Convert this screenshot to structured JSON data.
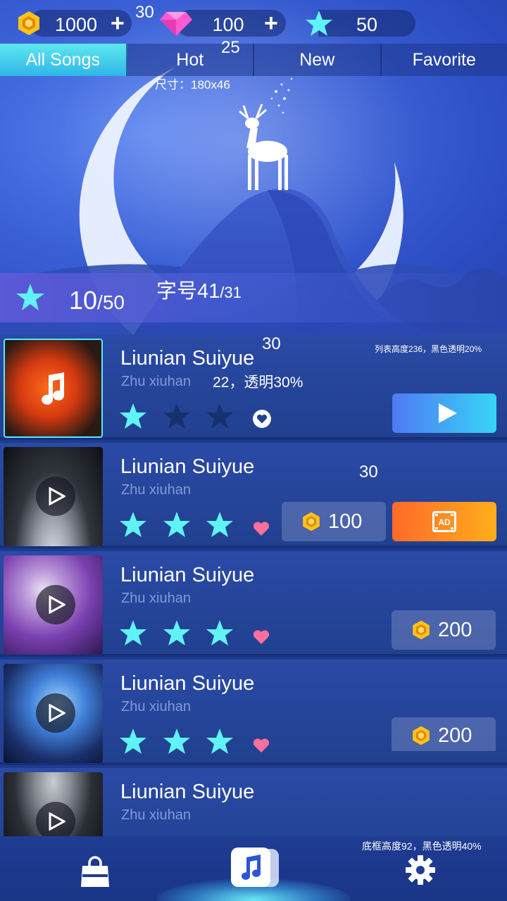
{
  "currency": {
    "coins": "1000",
    "gems": "100",
    "stars": "50",
    "plus": "+",
    "annotation_gap": "30",
    "annotation_font": "25",
    "annotation_size": "尺寸：180x46"
  },
  "tabs": [
    {
      "label": "All Songs",
      "active": true
    },
    {
      "label": "Hot",
      "active": false
    },
    {
      "label": "New",
      "active": false
    },
    {
      "label": "Favorite",
      "active": false
    }
  ],
  "progress": {
    "current": "10",
    "total": "/50",
    "annotation_font": "字号41",
    "annotation_font_small": "/31"
  },
  "songs": [
    {
      "title": "Liunian Suiyue",
      "artist": "Zhu xiuhan",
      "stars": 1,
      "favorite": false,
      "action": "play"
    },
    {
      "title": "Liunian Suiyue",
      "artist": "Zhu xiuhan",
      "stars": 3,
      "favorite": true,
      "action": "buy_or_ad",
      "price": "100"
    },
    {
      "title": "Liunian Suiyue",
      "artist": "Zhu xiuhan",
      "stars": 3,
      "favorite": true,
      "action": "buy",
      "price": "200"
    },
    {
      "title": "Liunian Suiyue",
      "artist": "Zhu xiuhan",
      "stars": 3,
      "favorite": true,
      "action": "buy",
      "price": "200"
    },
    {
      "title": "Liunian Suiyue",
      "artist": "Zhu xiuhan"
    }
  ],
  "list_annotations": {
    "title_gap": "30",
    "artist_note": "22，透明30%",
    "list_note": "列表高度236，黑色透明20%",
    "btn_gap": "30"
  },
  "bottom_nav": {
    "annotation": "底框高度92，黑色透明40%",
    "items": [
      "shop-bag-icon",
      "music-note-icon",
      "gear-icon"
    ]
  },
  "colors": {
    "accent_cyan": "#55e9ff",
    "star_cyan": "#5ff3f5",
    "star_dark": "#17306f",
    "heart_pink": "#ff6f9c",
    "ad_orange": "#ff8a20",
    "coin_gold": "#ffc21a",
    "gem_pink": "#ff5ad0"
  }
}
